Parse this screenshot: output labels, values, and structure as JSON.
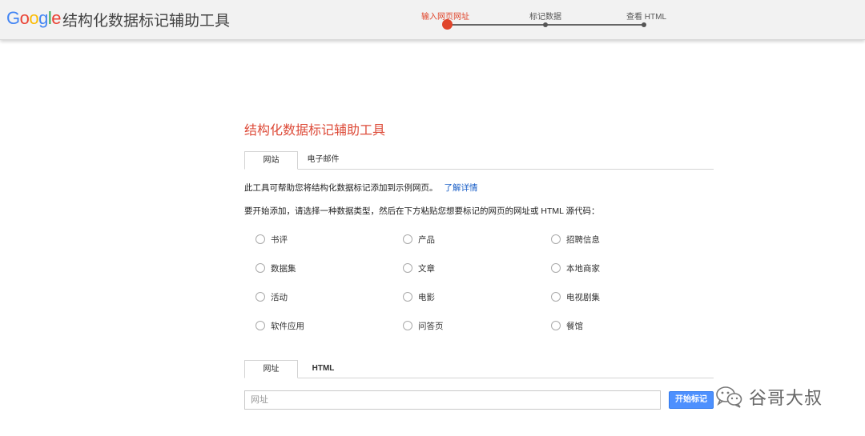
{
  "header": {
    "logo_letters": [
      {
        "ch": "G",
        "color": "#4285f4"
      },
      {
        "ch": "o",
        "color": "#ea4335"
      },
      {
        "ch": "o",
        "color": "#fbbc05"
      },
      {
        "ch": "g",
        "color": "#4285f4"
      },
      {
        "ch": "l",
        "color": "#34a853"
      },
      {
        "ch": "e",
        "color": "#ea4335"
      }
    ],
    "title": "结构化数据标记辅助工具",
    "steps": [
      {
        "label": "输入网页网址",
        "active": true
      },
      {
        "label": "标记数据",
        "active": false
      },
      {
        "label": "查看 HTML",
        "active": false
      }
    ]
  },
  "main": {
    "title": "结构化数据标记辅助工具",
    "source_tabs": [
      "网站",
      "电子邮件"
    ],
    "intro_text": "此工具可帮助您将结构化数据标记添加到示例网页。",
    "learn_more": "了解详情",
    "instruction": "要开始添加，请选择一种数据类型，然后在下方粘贴您想要标记的网页的网址或 HTML 源代码：",
    "data_types": [
      [
        "书评",
        "产品",
        "招聘信息"
      ],
      [
        "数据集",
        "文章",
        "本地商家"
      ],
      [
        "活动",
        "电影",
        "电视剧集"
      ],
      [
        "软件应用",
        "问答页",
        "餐馆"
      ]
    ],
    "input_tabs": [
      "网址",
      "HTML"
    ],
    "url_placeholder": "网址",
    "start_button": "开始标记"
  },
  "watermark": {
    "text": "谷哥大叔",
    "icon": "wechat-icon"
  },
  "colors": {
    "accent_red": "#dd4b39",
    "step_active": "#e0452b",
    "link_blue": "#1a5fc7",
    "button_blue": "#4d90fe"
  }
}
